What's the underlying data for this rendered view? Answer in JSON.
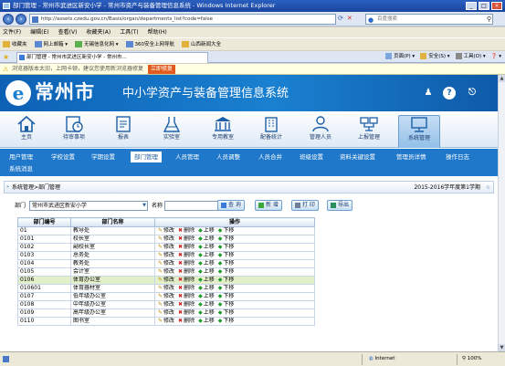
{
  "window": {
    "title": "部门管理 - 常州市武进区新安小学 - 常州市资产与装备管理信息系统 - Windows Internet Explorer",
    "controls": [
      "_",
      "□",
      "×"
    ]
  },
  "address_bar": {
    "url": "http://assets.czedu.gov.cn/Basis/organ/departments_list?code=false",
    "search_placeholder": "百度搜索"
  },
  "menubar": [
    "文件(F)",
    "编辑(E)",
    "查看(V)",
    "收藏夹(A)",
    "工具(T)",
    "帮助(H)"
  ],
  "favorites": [
    {
      "label": "收藏夹"
    },
    {
      "label": "网上邮箱 ▾"
    },
    {
      "label": "无锡信息化网 ▾"
    },
    {
      "label": "360安全上网导航"
    },
    {
      "label": "山西新闻大全"
    }
  ],
  "tab": {
    "title": "部门管理 - 常州市武进区新安小学 - 常州市...",
    "commands": [
      "页面(P) ▾",
      "安全(S) ▾",
      "工具(O) ▾",
      "❓ ▾"
    ]
  },
  "infobar": {
    "text": "浏览器版本太旧，上网卡顿，建议您使用新浏览器修复",
    "link": "立即修复"
  },
  "banner": {
    "logo": "e",
    "city": "常州市",
    "system_name": "中小学资产与装备管理信息系统"
  },
  "modules": [
    {
      "label": "主页",
      "icon": "home-icon"
    },
    {
      "label": "待审事项",
      "icon": "clock-icon"
    },
    {
      "label": "报表",
      "icon": "report-icon"
    },
    {
      "label": "实验室",
      "icon": "lab-icon"
    },
    {
      "label": "专用教室",
      "icon": "classroom-icon"
    },
    {
      "label": "配备统计",
      "icon": "stats-icon"
    },
    {
      "label": "管理人员",
      "icon": "person-icon"
    },
    {
      "label": "上报管理",
      "icon": "upload-icon"
    },
    {
      "label": "系统管理",
      "icon": "system-icon"
    }
  ],
  "subnav": {
    "row1": [
      "用户管理",
      "学校设置",
      "学期设置",
      "部门管理",
      "人员管理",
      "人员调整",
      "人员合并",
      "班级设置",
      "资料关键设置",
      "管理员详情",
      "操作日志"
    ],
    "row2": [
      "系统消息"
    ],
    "active": "部门管理"
  },
  "content": {
    "breadcrumb": "系统管理>部门管理",
    "term": "2015-2016学年度第1学期",
    "filter": {
      "dept_label": "部门",
      "dept_value": "常州市武进区新安小学",
      "name_label": "名称"
    },
    "buttons": {
      "search": "查 询",
      "add": "新 增",
      "print": "打 印",
      "export": "导出"
    },
    "table": {
      "headers": [
        "部门编号",
        "部门名称",
        "操作"
      ],
      "ops": {
        "edit": "修改",
        "delete": "删除",
        "up": "上移",
        "down": "下移"
      },
      "rows": [
        {
          "code": "01",
          "name": "教导处",
          "hl": false
        },
        {
          "code": "0101",
          "name": "校长室",
          "hl": false
        },
        {
          "code": "0102",
          "name": "副校长室",
          "hl": false
        },
        {
          "code": "0103",
          "name": "总务处",
          "hl": false
        },
        {
          "code": "0104",
          "name": "教务处",
          "hl": false
        },
        {
          "code": "0105",
          "name": "会计室",
          "hl": false
        },
        {
          "code": "0106",
          "name": "体育办公室",
          "hl": true
        },
        {
          "code": "010601",
          "name": "体育器材室",
          "hl": false
        },
        {
          "code": "0107",
          "name": "低年级办公室",
          "hl": false
        },
        {
          "code": "0108",
          "name": "中年级办公室",
          "hl": false
        },
        {
          "code": "0109",
          "name": "高年级办公室",
          "hl": false
        },
        {
          "code": "0110",
          "name": "图书室",
          "hl": false
        }
      ]
    }
  },
  "statusbar": {
    "zone": "Internet",
    "zoom": "100%"
  },
  "colors": {
    "banner_blue": "#1a80d0",
    "subnav_blue": "#1f78c9",
    "highlight_row": "#e3efc9"
  }
}
